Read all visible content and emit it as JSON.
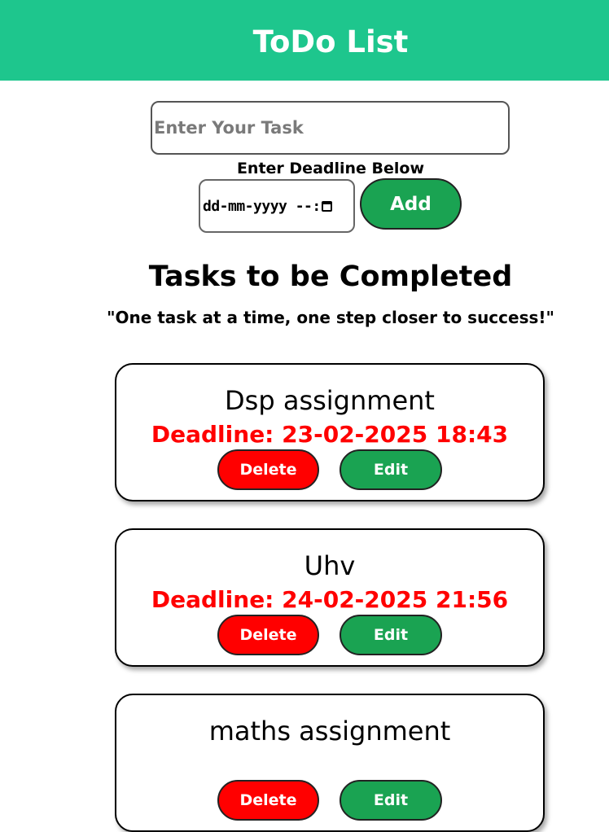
{
  "header": {
    "title": "ToDo List",
    "color": "#1ec68d"
  },
  "form": {
    "task_placeholder": "Enter Your Task",
    "task_value": "",
    "deadline_label": "Enter Deadline Below",
    "deadline_placeholder": "dd-mm-yyyy --:",
    "add_label": "Add"
  },
  "tasks_section": {
    "title": "Tasks to be Completed",
    "quote": "\"One task at a time, one step closer to success!\""
  },
  "tasks": [
    {
      "name": "Dsp assignment",
      "deadline": "Deadline: 23-02-2025 18:43",
      "delete_label": "Delete",
      "edit_label": "Edit"
    },
    {
      "name": "Uhv",
      "deadline": "Deadline: 24-02-2025 21:56",
      "delete_label": "Delete",
      "edit_label": "Edit"
    },
    {
      "name": "maths assignment",
      "deadline": "",
      "delete_label": "Delete",
      "edit_label": "Edit"
    }
  ],
  "colors": {
    "accent": "#1ec68d",
    "add_button": "#1aa352",
    "delete_button": "#ff0000",
    "deadline_text": "#ff0000"
  }
}
